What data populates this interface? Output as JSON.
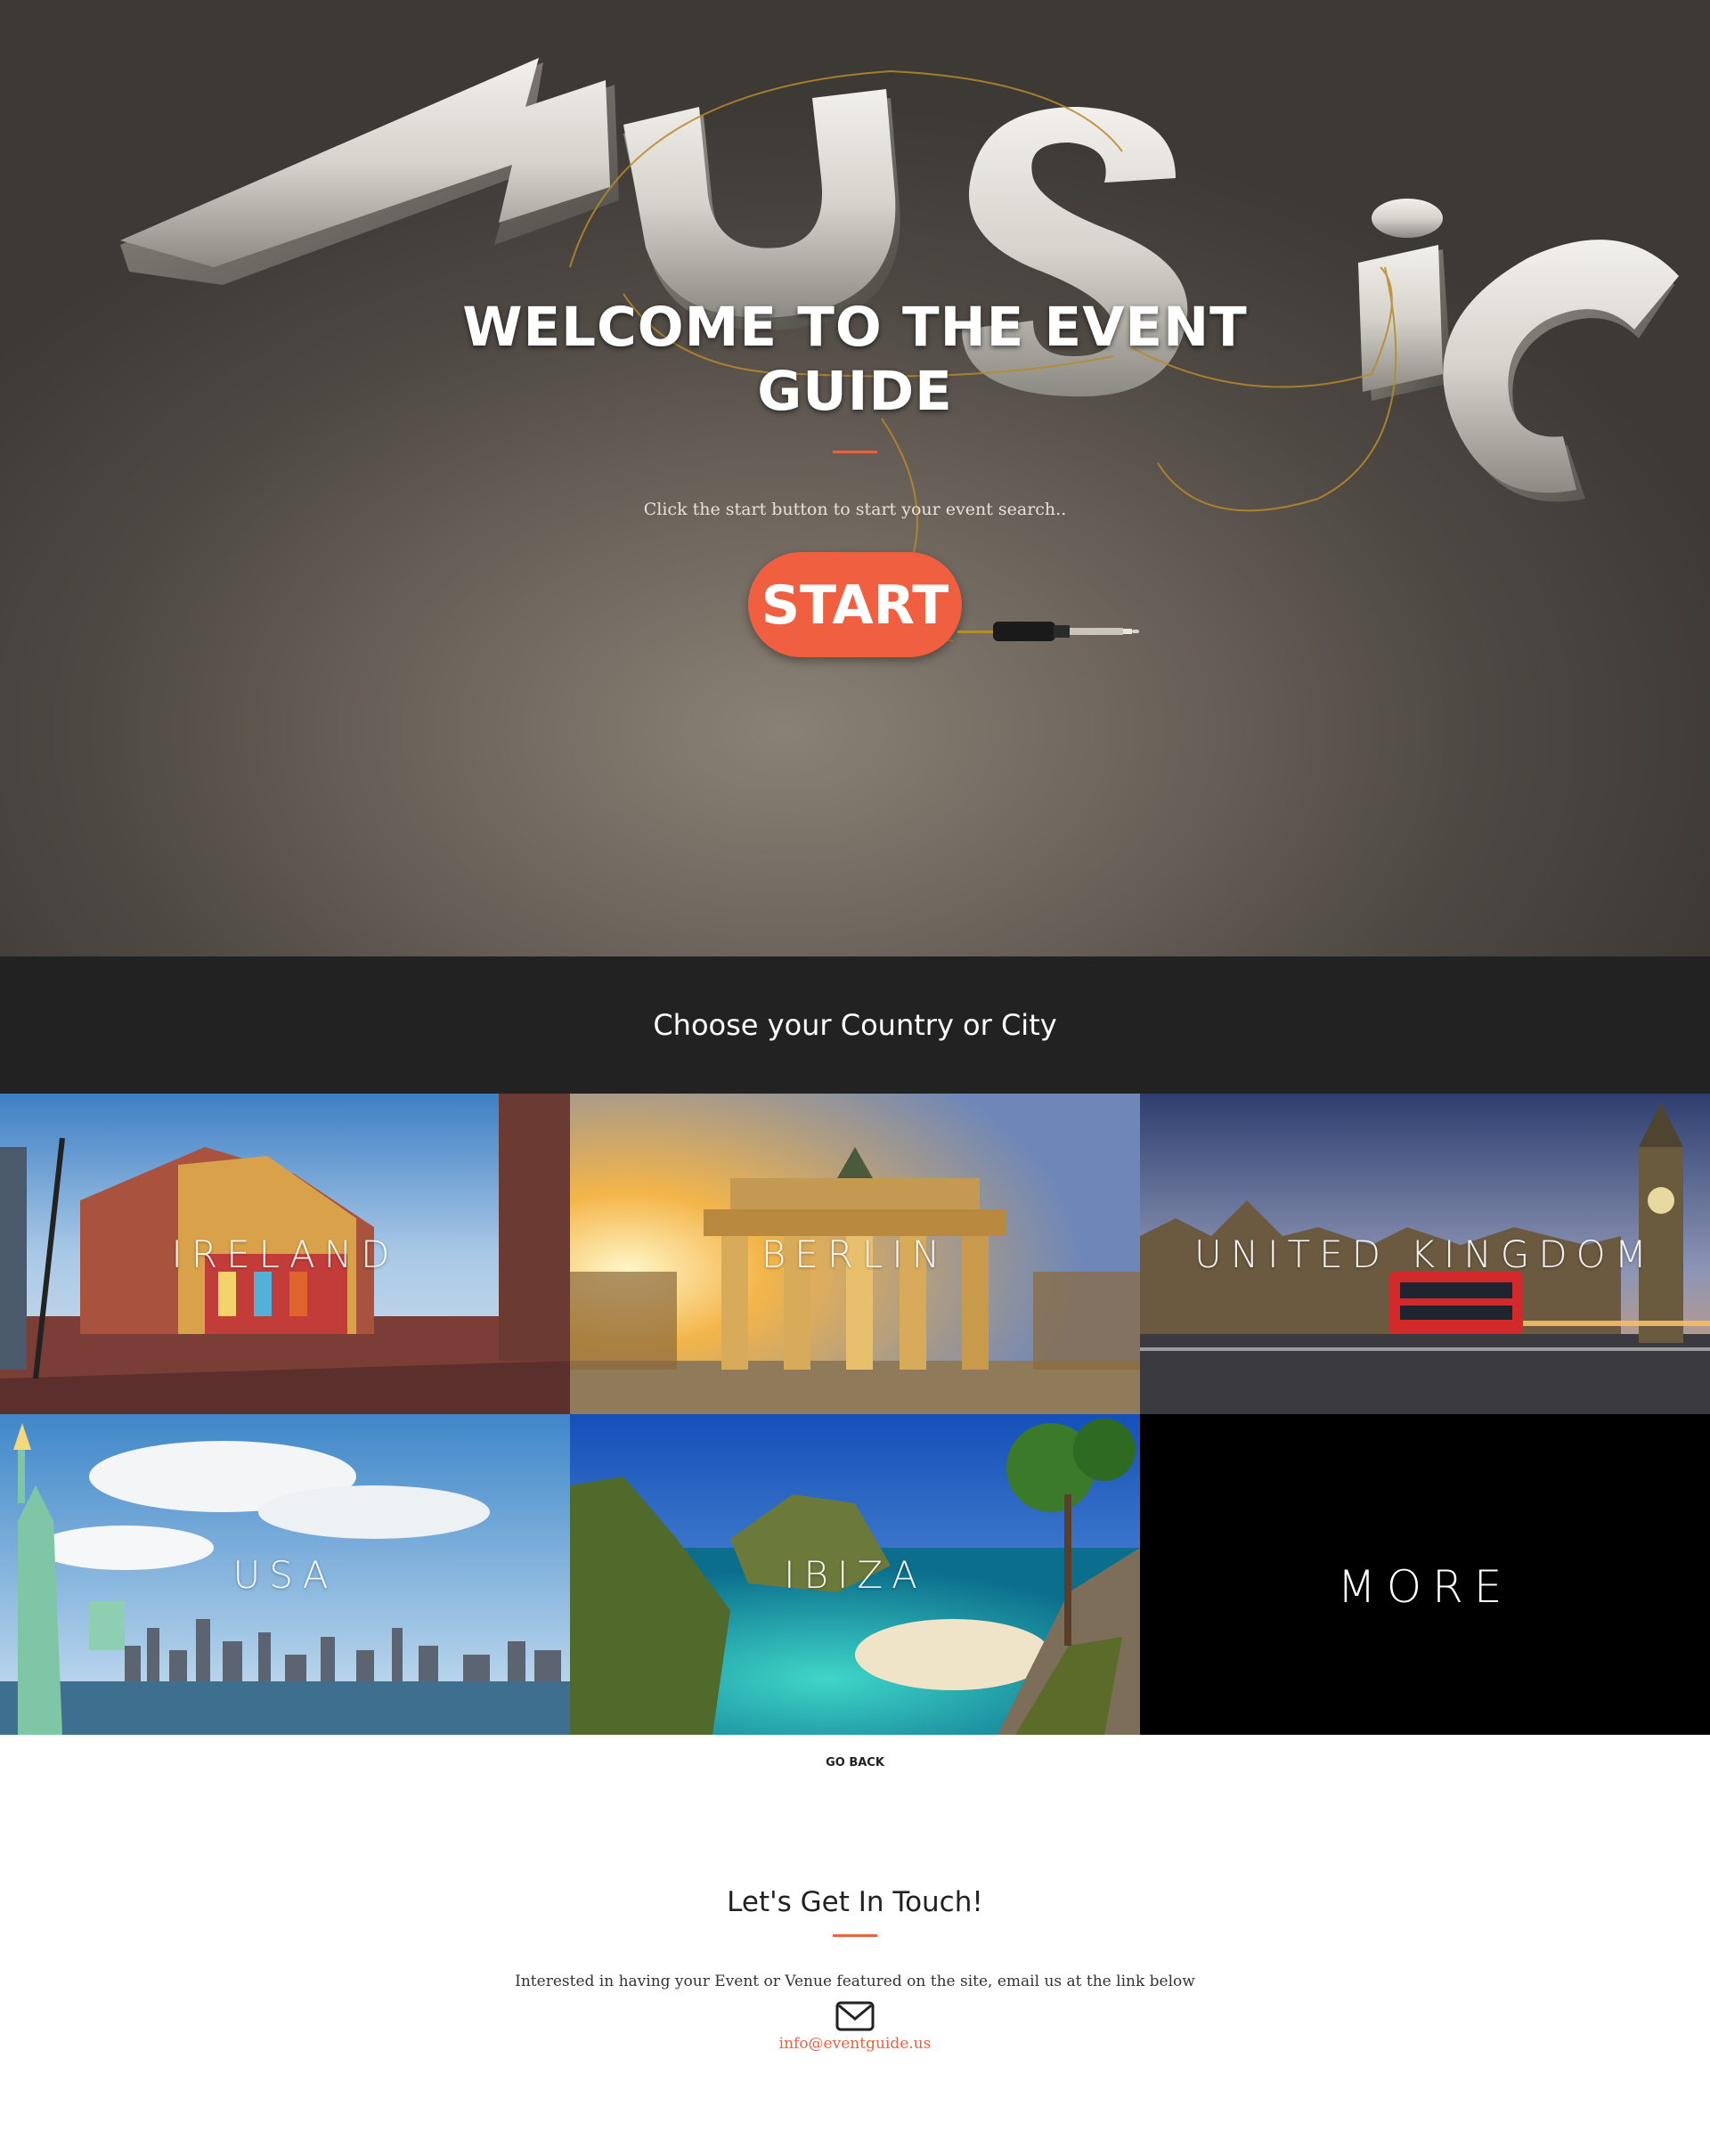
{
  "hero": {
    "title": "WELCOME TO THE EVENT GUIDE",
    "subtitle": "Click the start button to start your event search..",
    "start_label": "START",
    "background_word": "MUSiC"
  },
  "countries": {
    "heading": "Choose your Country or City",
    "tiles": [
      {
        "label": "IRELAND"
      },
      {
        "label": "BERLIN"
      },
      {
        "label": "UNITED KINGDOM"
      },
      {
        "label": "USA"
      },
      {
        "label": "IBIZA"
      },
      {
        "label": "MORE"
      }
    ],
    "go_back": "GO BACK"
  },
  "contact": {
    "title": "Let's Get In Touch!",
    "text": "Interested in having your Event or Venue featured on the site, email us at the link below",
    "email": "info@eventguide.us",
    "icon": "envelope-icon"
  },
  "colors": {
    "accent": "#f05f40",
    "dark_bar": "#222222",
    "more_tile": "#000000"
  }
}
